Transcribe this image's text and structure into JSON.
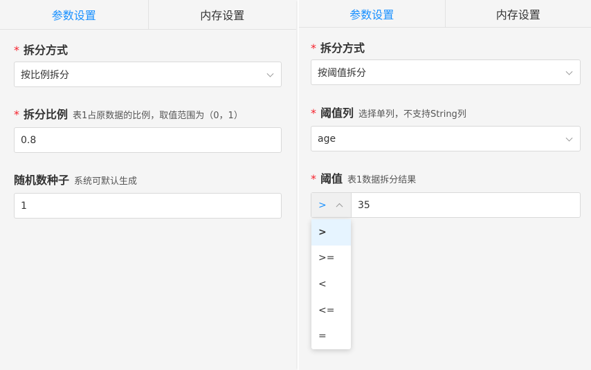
{
  "left_panel": {
    "tabs": [
      {
        "label": "参数设置",
        "active": true
      },
      {
        "label": "内存设置",
        "active": false
      }
    ],
    "split_method": {
      "required": "*",
      "label": "拆分方式",
      "value": "按比例拆分"
    },
    "split_ratio": {
      "required": "*",
      "label": "拆分比例",
      "hint": "表1占原数据的比例，取值范围为（0，1）",
      "value": "0.8"
    },
    "random_seed": {
      "label": "随机数种子",
      "hint": "系统可默认生成",
      "value": "1"
    }
  },
  "right_panel": {
    "tabs": [
      {
        "label": "参数设置",
        "active": true
      },
      {
        "label": "内存设置",
        "active": false
      }
    ],
    "split_method": {
      "required": "*",
      "label": "拆分方式",
      "value": "按阈值拆分"
    },
    "threshold_column": {
      "required": "*",
      "label": "阈值列",
      "hint": "选择单列，不支持String列",
      "value": "age"
    },
    "threshold": {
      "required": "*",
      "label": "阈值",
      "hint": "表1数据拆分结果",
      "operator": ">",
      "value": "35",
      "operator_options": [
        ">",
        ">=",
        "<",
        "<=",
        "="
      ]
    }
  },
  "colors": {
    "accent": "#1890ff",
    "required": "#f5222d",
    "selected_bg": "#e6f4ff"
  }
}
